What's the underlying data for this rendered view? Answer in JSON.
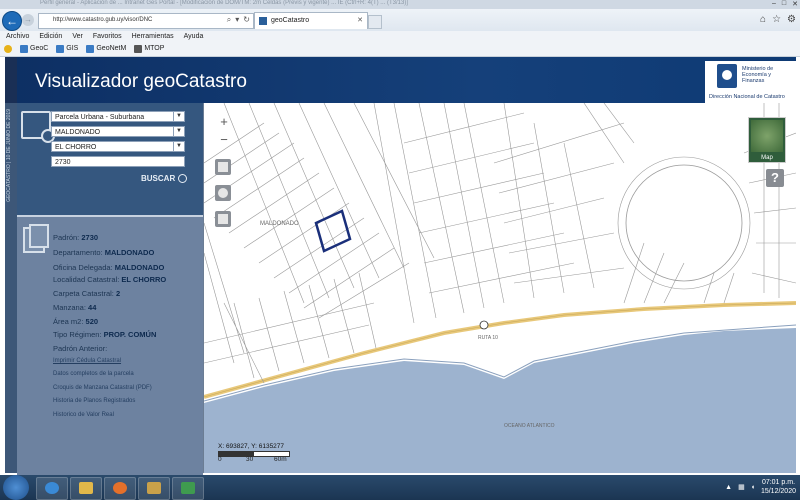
{
  "browser": {
    "window_title": "Perfil general - Aplicación de ... Intranet Ges Portal - [Modificación de DOM/TM: 2m Celdas (Previs y vigente) ... IE (Ctrl+R: 4(T) ... (T3/13)]",
    "url": "http://www.catastro.gub.uy/visor/DNC",
    "tab_title": "geoCatastro",
    "menu": [
      "Archivo",
      "Edición",
      "Ver",
      "Favoritos",
      "Herramientas",
      "Ayuda"
    ],
    "favorites": [
      "GeoC",
      "GIS",
      "GeoNetM",
      "MTOP"
    ]
  },
  "app": {
    "title": "Visualizador geoCatastro",
    "logo_text": "Ministerio de Economía y Finanzas",
    "logo_sub": "Dirección Nacional de Catastro",
    "side_strip": "GEOCATASTRO | 10 DE JUNIO DE 2019"
  },
  "search": {
    "type": "Parcela Urbana - Suburbana",
    "department": "MALDONADO",
    "locality": "EL CHORRO",
    "padron": "2730",
    "button": "BUSCAR"
  },
  "info": {
    "padron_label": "Padrón:",
    "padron": "2730",
    "departamento_label": "Departamento:",
    "departamento": "MALDONADO",
    "oficina_label": "Oficina Delegada:",
    "oficina": "MALDONADO",
    "localidad_label": "Localidad Catastral:",
    "localidad": "EL CHORRO",
    "carpeta_label": "Carpeta Catastral:",
    "carpeta": "2",
    "manzana_label": "Manzana:",
    "manzana": "44",
    "area_label": "Área m2:",
    "area": "520",
    "regimen_label": "Tipo Régimen:",
    "regimen": "PROP. COMÚN",
    "padron_anterior_label": "Padrón Anterior:",
    "links": [
      "Imprimir Cédula Catastral",
      "Datos completos de la parcela",
      "Croquis de Manzana Catastral (PDF)",
      "Historia de Planos Registrados",
      "Historico de Valor Real"
    ]
  },
  "map": {
    "zoom_in": "+",
    "zoom_out": "−",
    "thumb_label": "Map",
    "help": "?",
    "coords": "X: 693827, Y: 6135277",
    "scale_labels": [
      "0",
      "30",
      "60m"
    ],
    "labels": {
      "maldonado": "MALDONADO",
      "ocean": "OCEANO ATLANTICO",
      "road": "RUTA 10"
    }
  },
  "taskbar": {
    "time": "07:01 p.m.",
    "date": "15/12/2020"
  },
  "colors": {
    "header": "#0d2f63",
    "sea": "#9db3cf",
    "road": "#e8c87a",
    "parcel_highlight": "#1a2f7a"
  }
}
